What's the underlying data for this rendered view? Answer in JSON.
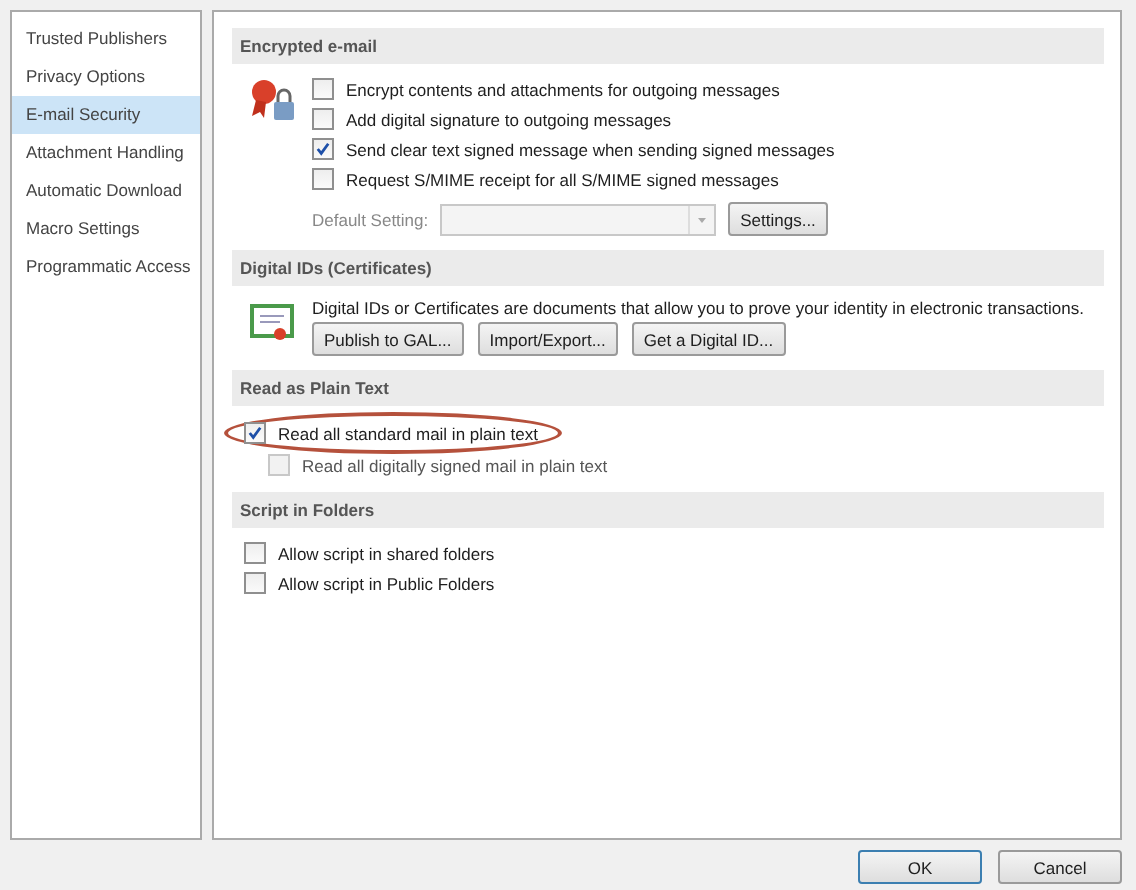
{
  "sidebar": {
    "items": [
      {
        "label": "Trusted Publishers",
        "selected": false
      },
      {
        "label": "Privacy Options",
        "selected": false
      },
      {
        "label": "E-mail Security",
        "selected": true
      },
      {
        "label": "Attachment Handling",
        "selected": false
      },
      {
        "label": "Automatic Download",
        "selected": false
      },
      {
        "label": "Macro Settings",
        "selected": false
      },
      {
        "label": "Programmatic Access",
        "selected": false
      }
    ]
  },
  "sections": [
    {
      "title": "Encrypted e-mail",
      "items": [
        {
          "kind": "checkbox",
          "label": "Encrypt contents and attachments for outgoing messages",
          "checked": false
        },
        {
          "kind": "checkbox",
          "label": "Add digital signature to outgoing messages",
          "checked": false
        },
        {
          "kind": "checkbox",
          "label": "Send clear text signed message when sending signed messages",
          "checked": true
        },
        {
          "kind": "checkbox",
          "label": "Request S/MIME receipt for all S/MIME signed messages",
          "checked": false
        },
        {
          "kind": "select",
          "label": "Default Setting:",
          "disabled": true,
          "button": "Settings..."
        }
      ]
    },
    {
      "title": "Digital IDs (Certificates)",
      "items": [
        {
          "kind": "text",
          "text": "Digital IDs or Certificates are documents that allow you to prove your identity in electronic transactions."
        },
        {
          "kind": "buttons",
          "buttons": [
            "Publish to GAL...",
            "Import/Export...",
            "Get a Digital ID..."
          ]
        }
      ]
    },
    {
      "title": "Read as Plain Text",
      "items": [
        {
          "kind": "checkbox",
          "label": "Read all standard mail in plain text",
          "checked": true,
          "circled": true
        },
        {
          "kind": "checkbox",
          "label": "Read all digitally signed mail in plain text",
          "checked": false,
          "disabled": true
        }
      ]
    },
    {
      "title": "Script in Folders",
      "items": [
        {
          "kind": "checkbox",
          "label": "Allow script in shared folders",
          "checked": false
        },
        {
          "kind": "checkbox",
          "label": "Allow script in Public Folders",
          "checked": false
        }
      ]
    }
  ],
  "buttons": [
    {
      "label": "OK",
      "default": true
    },
    {
      "label": "Cancel",
      "default": false
    }
  ]
}
